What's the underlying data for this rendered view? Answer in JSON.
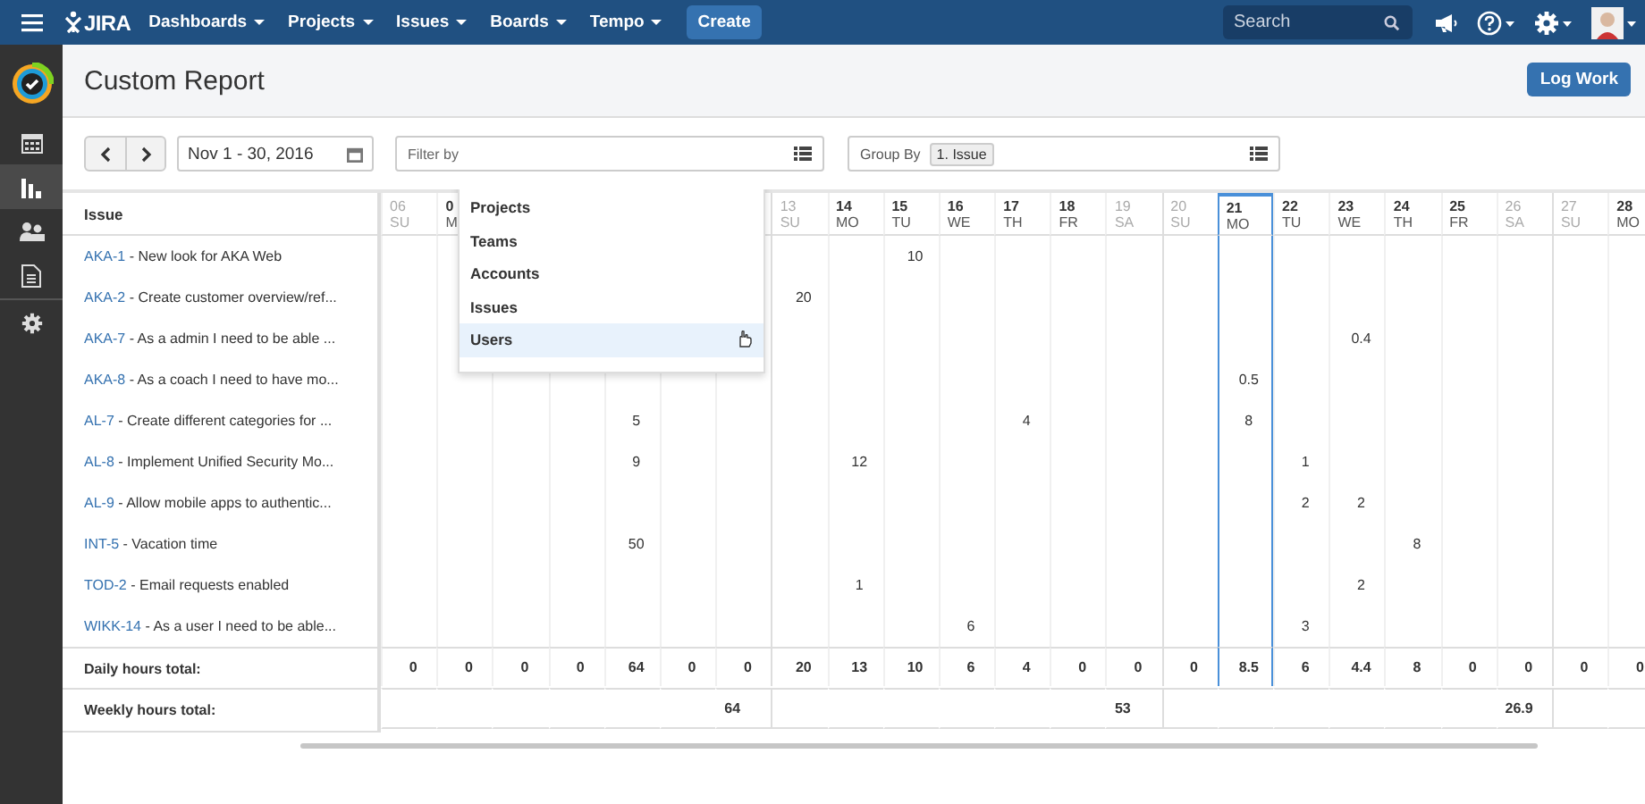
{
  "topbar": {
    "logo": "JIRA",
    "menus": [
      {
        "label": "Dashboards"
      },
      {
        "label": "Projects"
      },
      {
        "label": "Issues"
      },
      {
        "label": "Boards"
      },
      {
        "label": "Tempo"
      }
    ],
    "create": "Create",
    "search": {
      "placeholder": "Search"
    }
  },
  "sidebar": {
    "items": [
      {
        "kind": "calendar",
        "selected": false
      },
      {
        "kind": "chart",
        "selected": true
      },
      {
        "kind": "people",
        "selected": false
      },
      {
        "kind": "document",
        "selected": false
      },
      {
        "kind": "gear",
        "selected": false
      }
    ]
  },
  "header": {
    "title": "Custom Report",
    "log_work": "Log Work"
  },
  "toolbar": {
    "period": "Nov 1 - 30, 2016",
    "filter": {
      "placeholder": "Filter by"
    },
    "group_by": {
      "label": "Group By",
      "tag": "1. Issue"
    }
  },
  "filter_menu": {
    "items": [
      {
        "label": "Projects",
        "selected": false
      },
      {
        "label": "Teams",
        "selected": false
      },
      {
        "label": "Accounts",
        "selected": false
      },
      {
        "label": "Issues",
        "selected": false
      },
      {
        "label": "Users",
        "selected": true
      }
    ]
  },
  "table": {
    "issue_heading": "Issue",
    "columns": [
      {
        "day": "06",
        "weekday": "SU",
        "weekend": true,
        "selected": false,
        "total": "0"
      },
      {
        "day": "0",
        "weekday": "M",
        "weekend": false,
        "total": "0"
      },
      {
        "total": "0"
      },
      {
        "total": "0"
      },
      {
        "total": "64"
      },
      {
        "total": "0"
      },
      {
        "total": "0",
        "weekly_total": "64"
      },
      {
        "day": "13",
        "weekday": "SU",
        "weekend": true,
        "selected": false,
        "total": "20"
      },
      {
        "day": "14",
        "weekday": "MO",
        "weekend": false,
        "selected": false,
        "total": "13"
      },
      {
        "day": "15",
        "weekday": "TU",
        "weekend": false,
        "selected": false,
        "total": "10"
      },
      {
        "day": "16",
        "weekday": "WE",
        "weekend": false,
        "selected": false,
        "total": "6"
      },
      {
        "day": "17",
        "weekday": "TH",
        "weekend": false,
        "selected": false,
        "total": "4"
      },
      {
        "day": "18",
        "weekday": "FR",
        "weekend": false,
        "selected": false,
        "total": "0"
      },
      {
        "day": "19",
        "weekday": "SA",
        "weekend": true,
        "selected": false,
        "total": "0",
        "weekly_total": "53"
      },
      {
        "day": "20",
        "weekday": "SU",
        "weekend": true,
        "selected": false,
        "total": "0"
      },
      {
        "day": "21",
        "weekday": "MO",
        "weekend": false,
        "selected": true,
        "total": "8.5"
      },
      {
        "day": "22",
        "weekday": "TU",
        "weekend": false,
        "selected": false,
        "total": "6"
      },
      {
        "day": "23",
        "weekday": "WE",
        "weekend": false,
        "selected": false,
        "total": "4.4"
      },
      {
        "day": "24",
        "weekday": "TH",
        "weekend": false,
        "selected": false,
        "total": "8"
      },
      {
        "day": "25",
        "weekday": "FR",
        "weekend": false,
        "selected": false,
        "total": "0"
      },
      {
        "day": "26",
        "weekday": "SA",
        "weekend": true,
        "selected": false,
        "total": "0",
        "weekly_total": "26.9"
      },
      {
        "day": "27",
        "weekday": "SU",
        "weekend": true,
        "selected": false,
        "total": "0"
      },
      {
        "day": "28",
        "weekday": "MO",
        "weekend": false,
        "selected": false,
        "total": "0"
      }
    ],
    "rows": [
      {
        "key": "AKA-1",
        "summary": "- New look for AKA Web",
        "hours": {
          "nov_15": "10"
        }
      },
      {
        "key": "AKA-2",
        "summary": "- Create customer overview/ref...",
        "hours": {
          "nov_13": "20"
        }
      },
      {
        "key": "AKA-7",
        "summary": "- As a admin I need to be able ...",
        "hours": {
          "nov_23": "0.4"
        }
      },
      {
        "key": "AKA-8",
        "summary": "- As a coach I need to have mo...",
        "hours": {
          "nov_21": "0.5"
        }
      },
      {
        "key": "AL-7",
        "summary": "- Create different categories for ...",
        "hours": {
          "nov_10": "5",
          "nov_17": "4",
          "nov_21": "8"
        }
      },
      {
        "key": "AL-8",
        "summary": "- Implement Unified Security Mo...",
        "hours": {
          "nov_10": "9",
          "nov_14": "12",
          "nov_22": "1"
        }
      },
      {
        "key": "AL-9",
        "summary": "- Allow mobile apps to authentic...",
        "hours": {
          "nov_22": "2",
          "nov_23": "2"
        }
      },
      {
        "key": "INT-5",
        "summary": "- Vacation time",
        "hours": {
          "nov_10": "50",
          "nov_24": "8"
        }
      },
      {
        "key": "TOD-2",
        "summary": "- Email requests enabled",
        "hours": {
          "nov_14": "1",
          "nov_23": "2"
        }
      },
      {
        "key": "WIKK-14",
        "summary": "- As a user I need to be able...",
        "hours": {
          "nov_16": "6",
          "nov_22": "3"
        }
      }
    ],
    "daily_label": "Daily hours total:",
    "weekly_label": "Weekly hours total:"
  }
}
